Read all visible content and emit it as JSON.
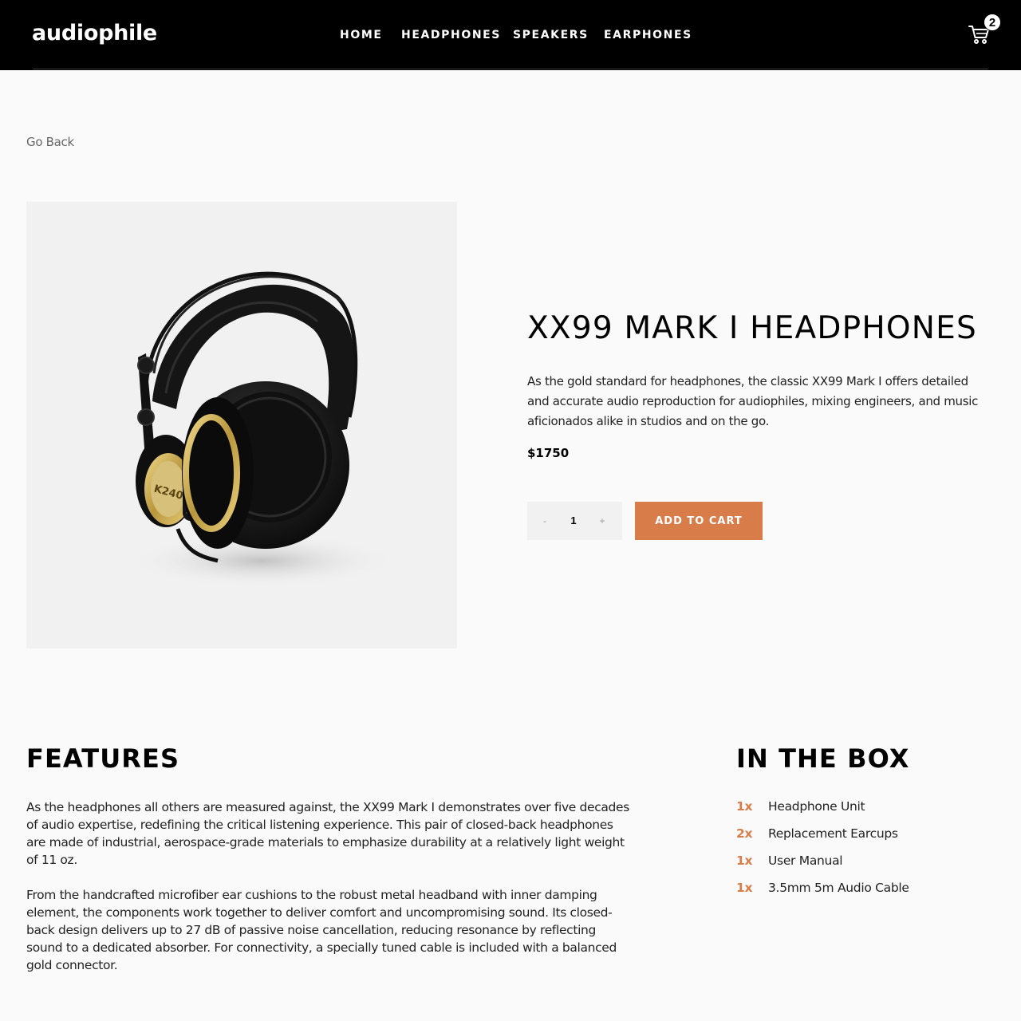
{
  "header": {
    "logo": "audiophile",
    "nav": [
      {
        "label": "HOME"
      },
      {
        "label": "HEADPHONES"
      },
      {
        "label": "SPEAKERS"
      },
      {
        "label": "EARPHONES"
      }
    ],
    "cart_count": "2"
  },
  "go_back": "Go Back",
  "product": {
    "title": "XX99 MARK I HEADPHONES",
    "description": "As the gold standard for headphones, the classic XX99 Mark I offers detailed and accurate audio reproduction for audiophiles, mixing engineers, and music aficionados alike in studios and on the go.",
    "price": "$1750",
    "quantity": {
      "minus": "-",
      "value": "1",
      "plus": "+"
    },
    "add_to_cart": "ADD TO CART",
    "image_text": "K240"
  },
  "features": {
    "heading": "FEATURES",
    "paragraphs": [
      "As the headphones all others are measured against, the XX99 Mark I demonstrates over five decades of audio expertise, redefining the critical listening experience. This pair of closed-back headphones are made of industrial, aerospace-grade materials to emphasize durability at a relatively light weight of 11 oz.",
      "From the handcrafted microfiber ear cushions to the robust metal headband with inner damping element, the components work together to deliver comfort and uncompromising sound. Its closed-back design delivers up to 27 dB of passive noise cancellation, reducing resonance by reflecting sound to a dedicated absorber. For connectivity, a specially tuned cable is included with a balanced gold connector."
    ]
  },
  "in_the_box": {
    "heading": "IN THE BOX",
    "items": [
      {
        "qty": "1x",
        "label": "Headphone Unit"
      },
      {
        "qty": "2x",
        "label": "Replacement Earcups"
      },
      {
        "qty": "1x",
        "label": "User Manual"
      },
      {
        "qty": "1x",
        "label": "3.5mm 5m Audio Cable"
      }
    ]
  },
  "colors": {
    "accent": "#d87d4a",
    "header_bg": "#000000",
    "page_bg": "#fafafa",
    "image_bg": "#f1f1f1"
  }
}
